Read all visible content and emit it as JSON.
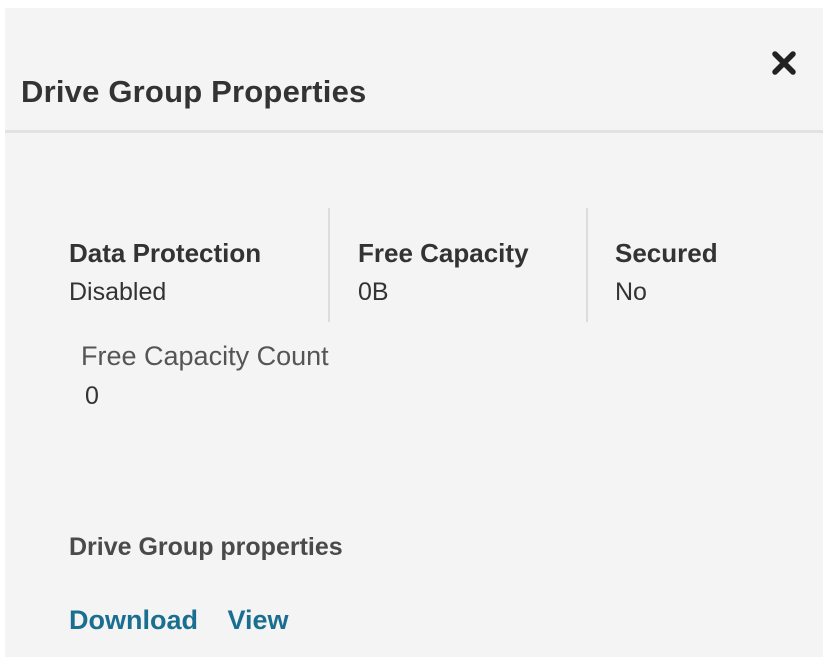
{
  "panel": {
    "title": "Drive Group Properties",
    "close_icon": "close-icon"
  },
  "stats": [
    {
      "label": "Data Protection",
      "value": "Disabled"
    },
    {
      "label": "Free Capacity",
      "value": "0B"
    },
    {
      "label": "Secured",
      "value": "No"
    }
  ],
  "free_capacity_count": {
    "label": "Free Capacity Count",
    "value": "0"
  },
  "properties_section": {
    "title": "Drive Group properties",
    "links": [
      "Download",
      "View"
    ]
  },
  "colors": {
    "background": "#f4f4f4",
    "text": "#333333",
    "link": "#1a6f91"
  }
}
